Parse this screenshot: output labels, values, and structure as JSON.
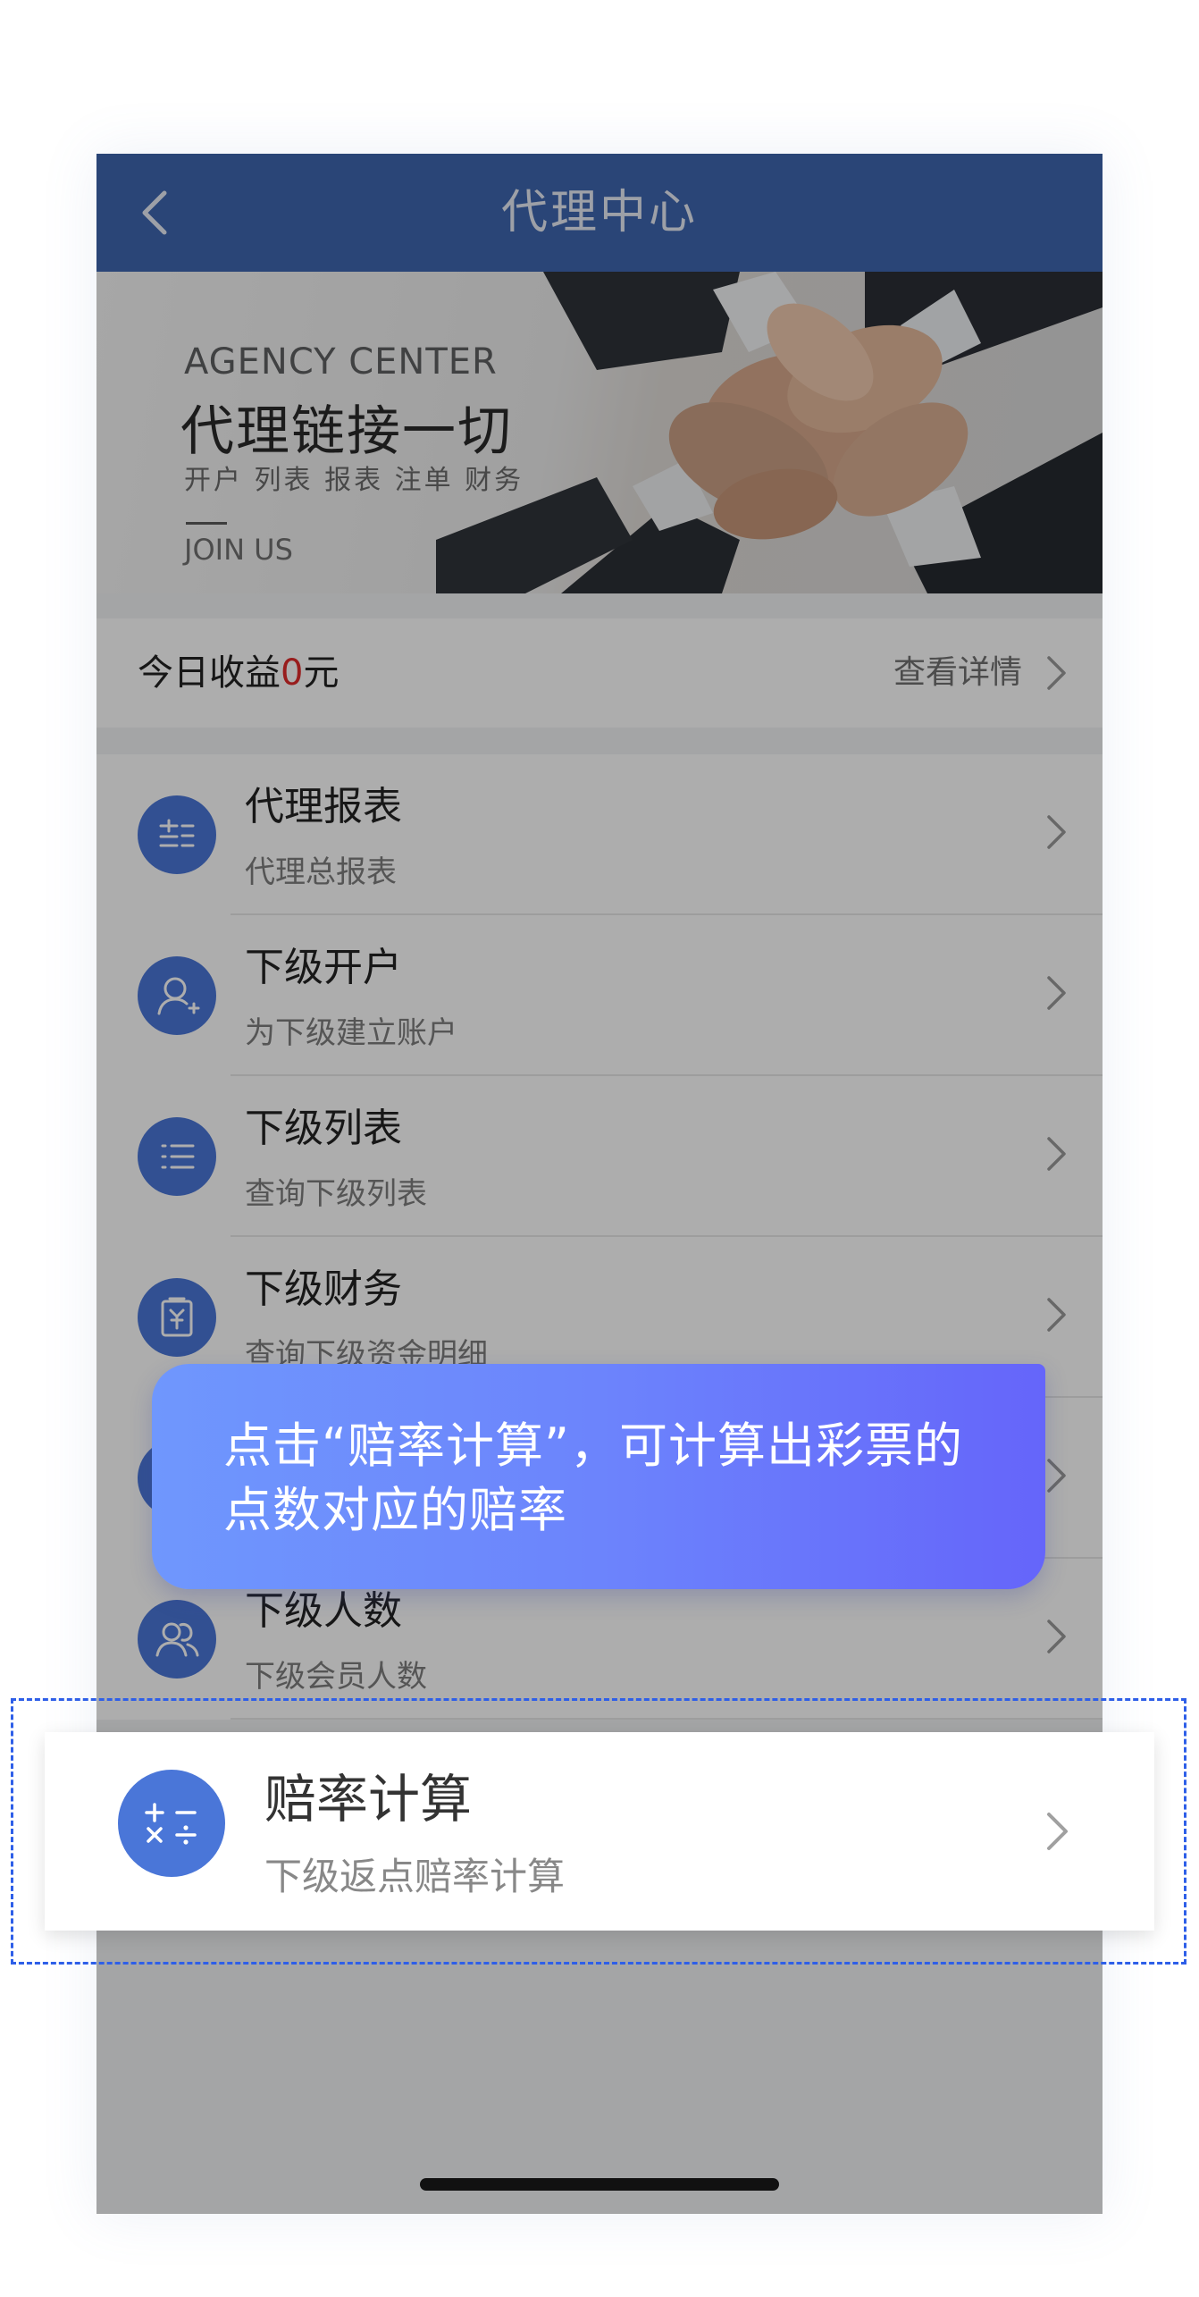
{
  "navbar": {
    "title": "代理中心",
    "back_icon": "chevron-left-icon"
  },
  "banner": {
    "heading_en": "AGENCY CENTER",
    "heading_cn": "代理链接一切",
    "subtitle": "开户 列表 报表 注单 财务",
    "join": "JOIN US"
  },
  "earnings": {
    "label": "今日收益",
    "value": "0",
    "unit": "元",
    "detail_label": "查看详情",
    "value_color": "#e02c2c"
  },
  "menu": {
    "items": [
      {
        "title": "代理报表",
        "subtitle": "代理总报表",
        "icon": "report-icon"
      },
      {
        "title": "下级开户",
        "subtitle": "为下级建立账户",
        "icon": "add-user-icon"
      },
      {
        "title": "下级列表",
        "subtitle": "查询下级列表",
        "icon": "list-icon"
      },
      {
        "title": "下级财务",
        "subtitle": "查询下级资金明细",
        "icon": "finance-icon"
      },
      {
        "title": "",
        "subtitle": "",
        "icon": "circle-icon"
      },
      {
        "title": "下级人数",
        "subtitle": "下级会员人数",
        "icon": "users-icon"
      }
    ]
  },
  "tip": {
    "text": "点击“赔率计算”，可计算出彩票的点数对应的赔率"
  },
  "highlight": {
    "title": "赔率计算",
    "subtitle": "下级返点赔率计算",
    "icon": "calculator-icon"
  },
  "colors": {
    "navbar": "#3f66b0",
    "icon_bg": "#4a76d8",
    "highlight_border": "#2e5fe8",
    "tip_gradient_start": "#6f97fd",
    "tip_gradient_end": "#6565fa"
  }
}
